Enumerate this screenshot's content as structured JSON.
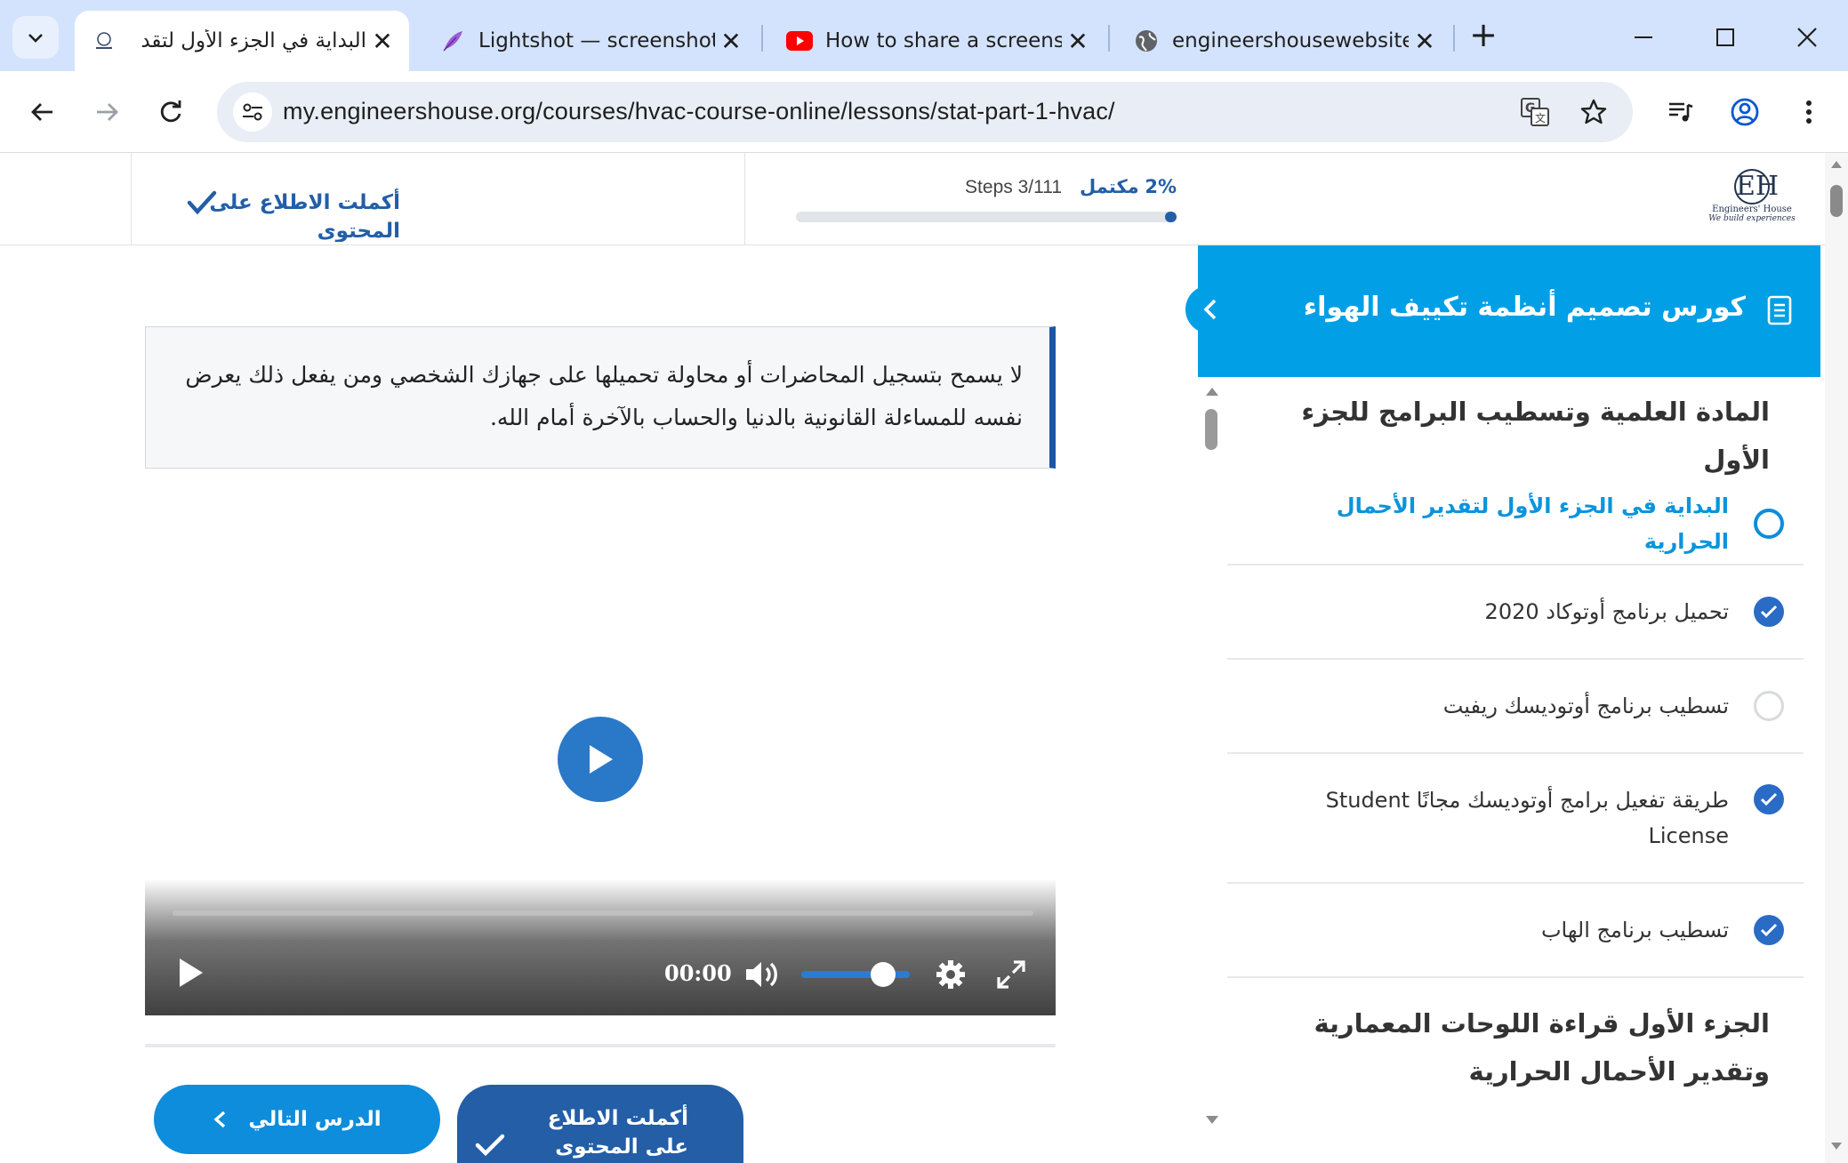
{
  "browser": {
    "tabs": [
      {
        "title": "البداية في الجزء الأول لتقد",
        "active": true,
        "icon": "engineers-house-favicon"
      },
      {
        "title": "Lightshot — screenshot",
        "active": false,
        "icon": "feather-icon"
      },
      {
        "title": "How to share a screens",
        "active": false,
        "icon": "youtube-icon"
      },
      {
        "title": "engineershousewebsite",
        "active": false,
        "icon": "globe-icon"
      }
    ],
    "url": "my.engineershouse.org/courses/hvac-course-online/lessons/stat-part-1-hvac/"
  },
  "header": {
    "complete_label": "أكملت الاطلاع على المحتوى",
    "progress_percent": "2%",
    "progress_label": "مكتمل",
    "progress_fraction": 0.03,
    "steps": "Steps 3/111",
    "logo": {
      "mark": "EH",
      "name": "Engineers' House",
      "tagline": "We build experiences"
    }
  },
  "notice": {
    "text": "لا يسمح بتسجيل المحاضرات أو محاولة تحميلها على جهازك الشخصي ومن يفعل ذلك يعرض نفسه للمساءلة القانونية بالدنيا والحساب بالآخرة أمام الله."
  },
  "player": {
    "time": "00:00",
    "volume_fraction": 0.75
  },
  "buttons": {
    "next": "الدرس التالي",
    "complete": "أكملت الاطلاع على المحتوى"
  },
  "sidebar": {
    "course_title": "كورس تصميم أنظمة تكييف الهواء",
    "sections": [
      {
        "title": "المادة العلمية وتسطيب البرامج للجزء الأول",
        "lessons": [
          {
            "title": "البداية في الجزء الأول لتقدير الأحمال الحرارية",
            "status": "current"
          },
          {
            "title": "تحميل برنامج أوتوكاد 2020",
            "status": "done"
          },
          {
            "title": "تسطيب برنامج أوتوديسك ريفيت",
            "status": "todo"
          },
          {
            "title": "طريقة تفعيل برامج أوتوديسك مجانًا Student License",
            "status": "done"
          },
          {
            "title": "تسطيب برنامج الهاب",
            "status": "done"
          }
        ]
      },
      {
        "title": "الجزء الأول قراءة اللوحات المعمارية وتقدير الأحمال الحرارية",
        "lessons": []
      }
    ]
  },
  "colors": {
    "accent": "#009fe6",
    "primary": "#235ea7",
    "check": "#2a6bc5"
  }
}
